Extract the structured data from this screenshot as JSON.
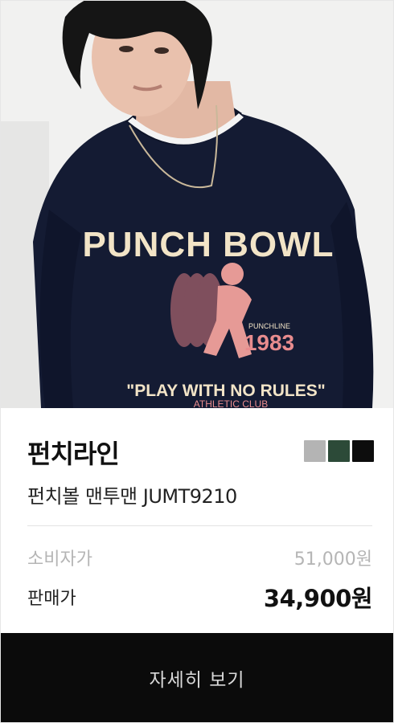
{
  "product": {
    "image_alt": "Model wearing navy sweatshirt with PUNCH BOWL print",
    "print_text": {
      "headline": "PUNCH BOWL",
      "small": "PUNCHLINE",
      "year": "1983",
      "slogan": "\"PLAY WITH NO RULES\"",
      "club": "ATHLETIC CLUB"
    },
    "brand": "펀치라인",
    "name": "펀치볼 맨투맨 JUMT9210",
    "colors": [
      "#b4b4b4",
      "#2c4a38",
      "#0d0d0d"
    ],
    "retail_label": "소비자가",
    "retail_price": "51,000원",
    "sale_label": "판매가",
    "sale_price": "34,900원"
  },
  "cta": {
    "label": "자세히 보기"
  }
}
